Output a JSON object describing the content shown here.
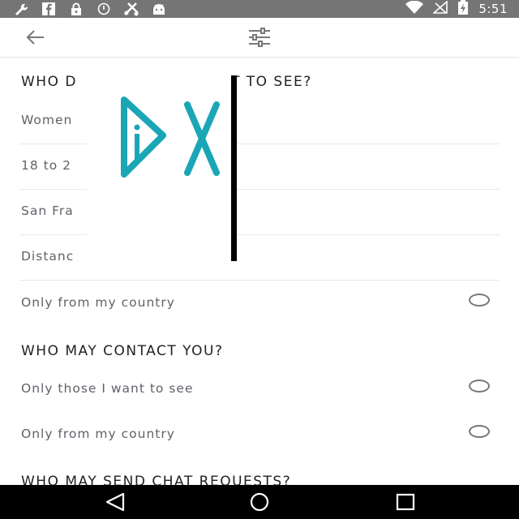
{
  "status_bar": {
    "time": "5:51",
    "icons": [
      "wrench-icon",
      "facebook-icon",
      "lock-icon",
      "alarm-icon",
      "scissors-icon",
      "android-icon",
      "wifi-icon",
      "no-signal-icon",
      "battery-charging-icon"
    ]
  },
  "app_bar": {
    "back_icon": "arrow-back-icon",
    "filter_icon": "tune-icon"
  },
  "sections": [
    {
      "title": "WHO D",
      "title_tail": "T TO SEE?",
      "rows": [
        {
          "label": "Women"
        },
        {
          "label": "18 to 2"
        },
        {
          "label": "San Fra"
        },
        {
          "label": "Distanc"
        },
        {
          "label": "Only from my country"
        }
      ]
    },
    {
      "title": "WHO MAY CONTACT YOU?",
      "rows": [
        {
          "label": "Only those I want to see"
        },
        {
          "label": "Only from my country"
        }
      ]
    },
    {
      "title": "WHO MAY SEND CHAT REQUESTS?"
    }
  ],
  "ad": {
    "logo_icon": "ad-choices-icon",
    "close_icon": "close-x-icon"
  },
  "nav_bar": {
    "icons": [
      "back-triangle-icon",
      "home-circle-icon",
      "recents-square-icon"
    ]
  },
  "colors": {
    "status_bar": "#757575",
    "nav_bar": "#000000",
    "ad_accent": "#1aa6b7"
  }
}
